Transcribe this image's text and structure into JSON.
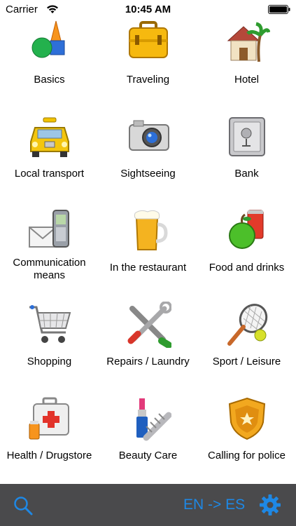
{
  "status": {
    "carrier": "Carrier",
    "time": "10:45 AM"
  },
  "categories": [
    {
      "label": "Basics",
      "icon": "shapes-icon"
    },
    {
      "label": "Traveling",
      "icon": "suitcase-icon"
    },
    {
      "label": "Hotel",
      "icon": "hotel-icon"
    },
    {
      "label": "Local transport",
      "icon": "taxi-icon"
    },
    {
      "label": "Sightseeing",
      "icon": "camera-icon"
    },
    {
      "label": "Bank",
      "icon": "safe-icon"
    },
    {
      "label": "Communication means",
      "icon": "mail-phone-icon"
    },
    {
      "label": "In the restaurant",
      "icon": "beer-icon"
    },
    {
      "label": "Food and drinks",
      "icon": "apple-can-icon"
    },
    {
      "label": "Shopping",
      "icon": "shopping-cart-icon"
    },
    {
      "label": "Repairs / Laundry",
      "icon": "tools-icon"
    },
    {
      "label": "Sport / Leisure",
      "icon": "tennis-icon"
    },
    {
      "label": "Health / Drugstore",
      "icon": "first-aid-icon"
    },
    {
      "label": "Beauty Care",
      "icon": "beauty-icon"
    },
    {
      "label": "Calling for police",
      "icon": "police-badge-icon"
    }
  ],
  "toolbar": {
    "language_pair": "EN -> ES",
    "search_icon": "search-icon",
    "settings_icon": "gear-icon",
    "accent": "#1e88e5",
    "background": "#4a4a4c"
  }
}
